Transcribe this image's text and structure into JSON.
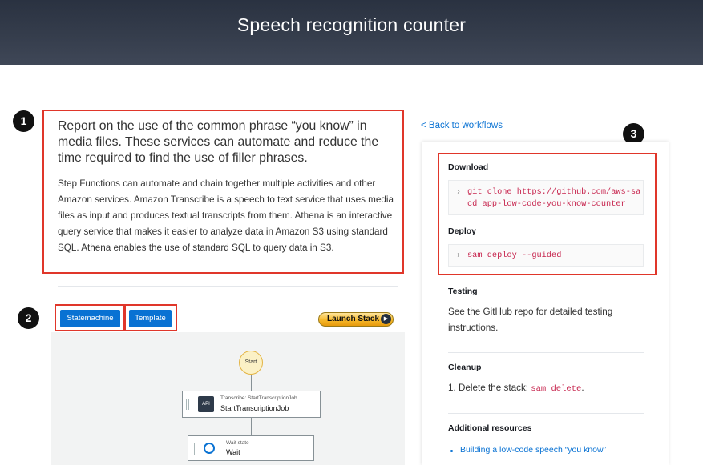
{
  "header": {
    "title": "Speech recognition counter"
  },
  "markers": [
    "1",
    "2",
    "3"
  ],
  "intro": {
    "heading": "Report on the use of the common phrase “you know” in media files. These services can automate and reduce the time required to find the use of filler phrases.",
    "body": "Step Functions can automate and chain together multiple activities and other Amazon services. Amazon Transcribe is a speech to text service that uses media files as input and produces textual transcripts from them. Athena is an interactive query service that makes it easier to analyze data in Amazon S3 using standard SQL. Athena enables the use of standard SQL to query data in S3."
  },
  "toolbar": {
    "statemachine_label": "Statemachine",
    "template_label": "Template",
    "launch_label": "Launch Stack"
  },
  "workflow": {
    "start_label": "Start",
    "node1": {
      "type": "Transcribe: StartTranscriptionJob",
      "name": "StartTranscriptionJob",
      "icon_text": "API"
    },
    "node2": {
      "type": "Wait state",
      "name": "Wait"
    }
  },
  "sidebar": {
    "back_link": "< Back to workflows",
    "download": {
      "title": "Download",
      "lines": [
        "git clone https://github.com/aws-sa",
        "cd app-low-code-you-know-counter"
      ]
    },
    "deploy": {
      "title": "Deploy",
      "command": "sam deploy --guided"
    },
    "testing": {
      "title": "Testing",
      "text": "See the GitHub repo for detailed testing instructions."
    },
    "cleanup": {
      "title": "Cleanup",
      "prefix": "1. Delete the stack: ",
      "command": "sam delete",
      "suffix": "."
    },
    "additional": {
      "title": "Additional resources",
      "links": [
        "Building a low-code speech “you know”"
      ]
    }
  },
  "colors": {
    "accent": "#0972d3",
    "highlight_border": "#e0362a",
    "code": "#c7254e"
  },
  "icons": [
    "chevron-right-icon",
    "play-arrow-icon",
    "api-icon",
    "clock-icon"
  ]
}
